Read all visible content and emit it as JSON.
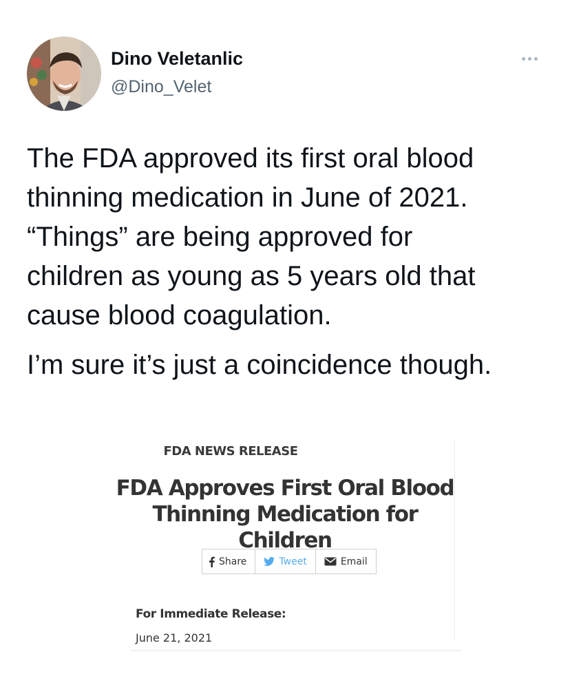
{
  "tweet": {
    "author": {
      "display_name": "Dino Veletanlic",
      "handle": "@Dino_Velet",
      "avatar": "profile-photo"
    },
    "more_icon": "more-horizontal-icon",
    "text": {
      "paragraph_1": [
        "The FDA approved its first oral blood",
        "thinning medication in June of 2021.",
        "“Things” are being approved for",
        "children as young as 5 years old that",
        "cause blood coagulation."
      ],
      "paragraph_2": "I’m sure it’s just a coincidence though."
    },
    "colors": {
      "text": "#0f1419",
      "secondary_text": "#536471",
      "tweet_blue": "#55acee"
    }
  },
  "attached_image": {
    "release_label": "FDA NEWS RELEASE",
    "headline_lines": [
      "FDA Approves First Oral Blood",
      "Thinning Medication for Children"
    ],
    "share_buttons": [
      {
        "label": "Share",
        "icon": "facebook-icon"
      },
      {
        "label": "Tweet",
        "icon": "twitter-bird-icon"
      },
      {
        "label": "Email",
        "icon": "envelope-icon"
      }
    ],
    "release_type_label": "For Immediate Release:",
    "release_date": "June 21, 2021"
  }
}
